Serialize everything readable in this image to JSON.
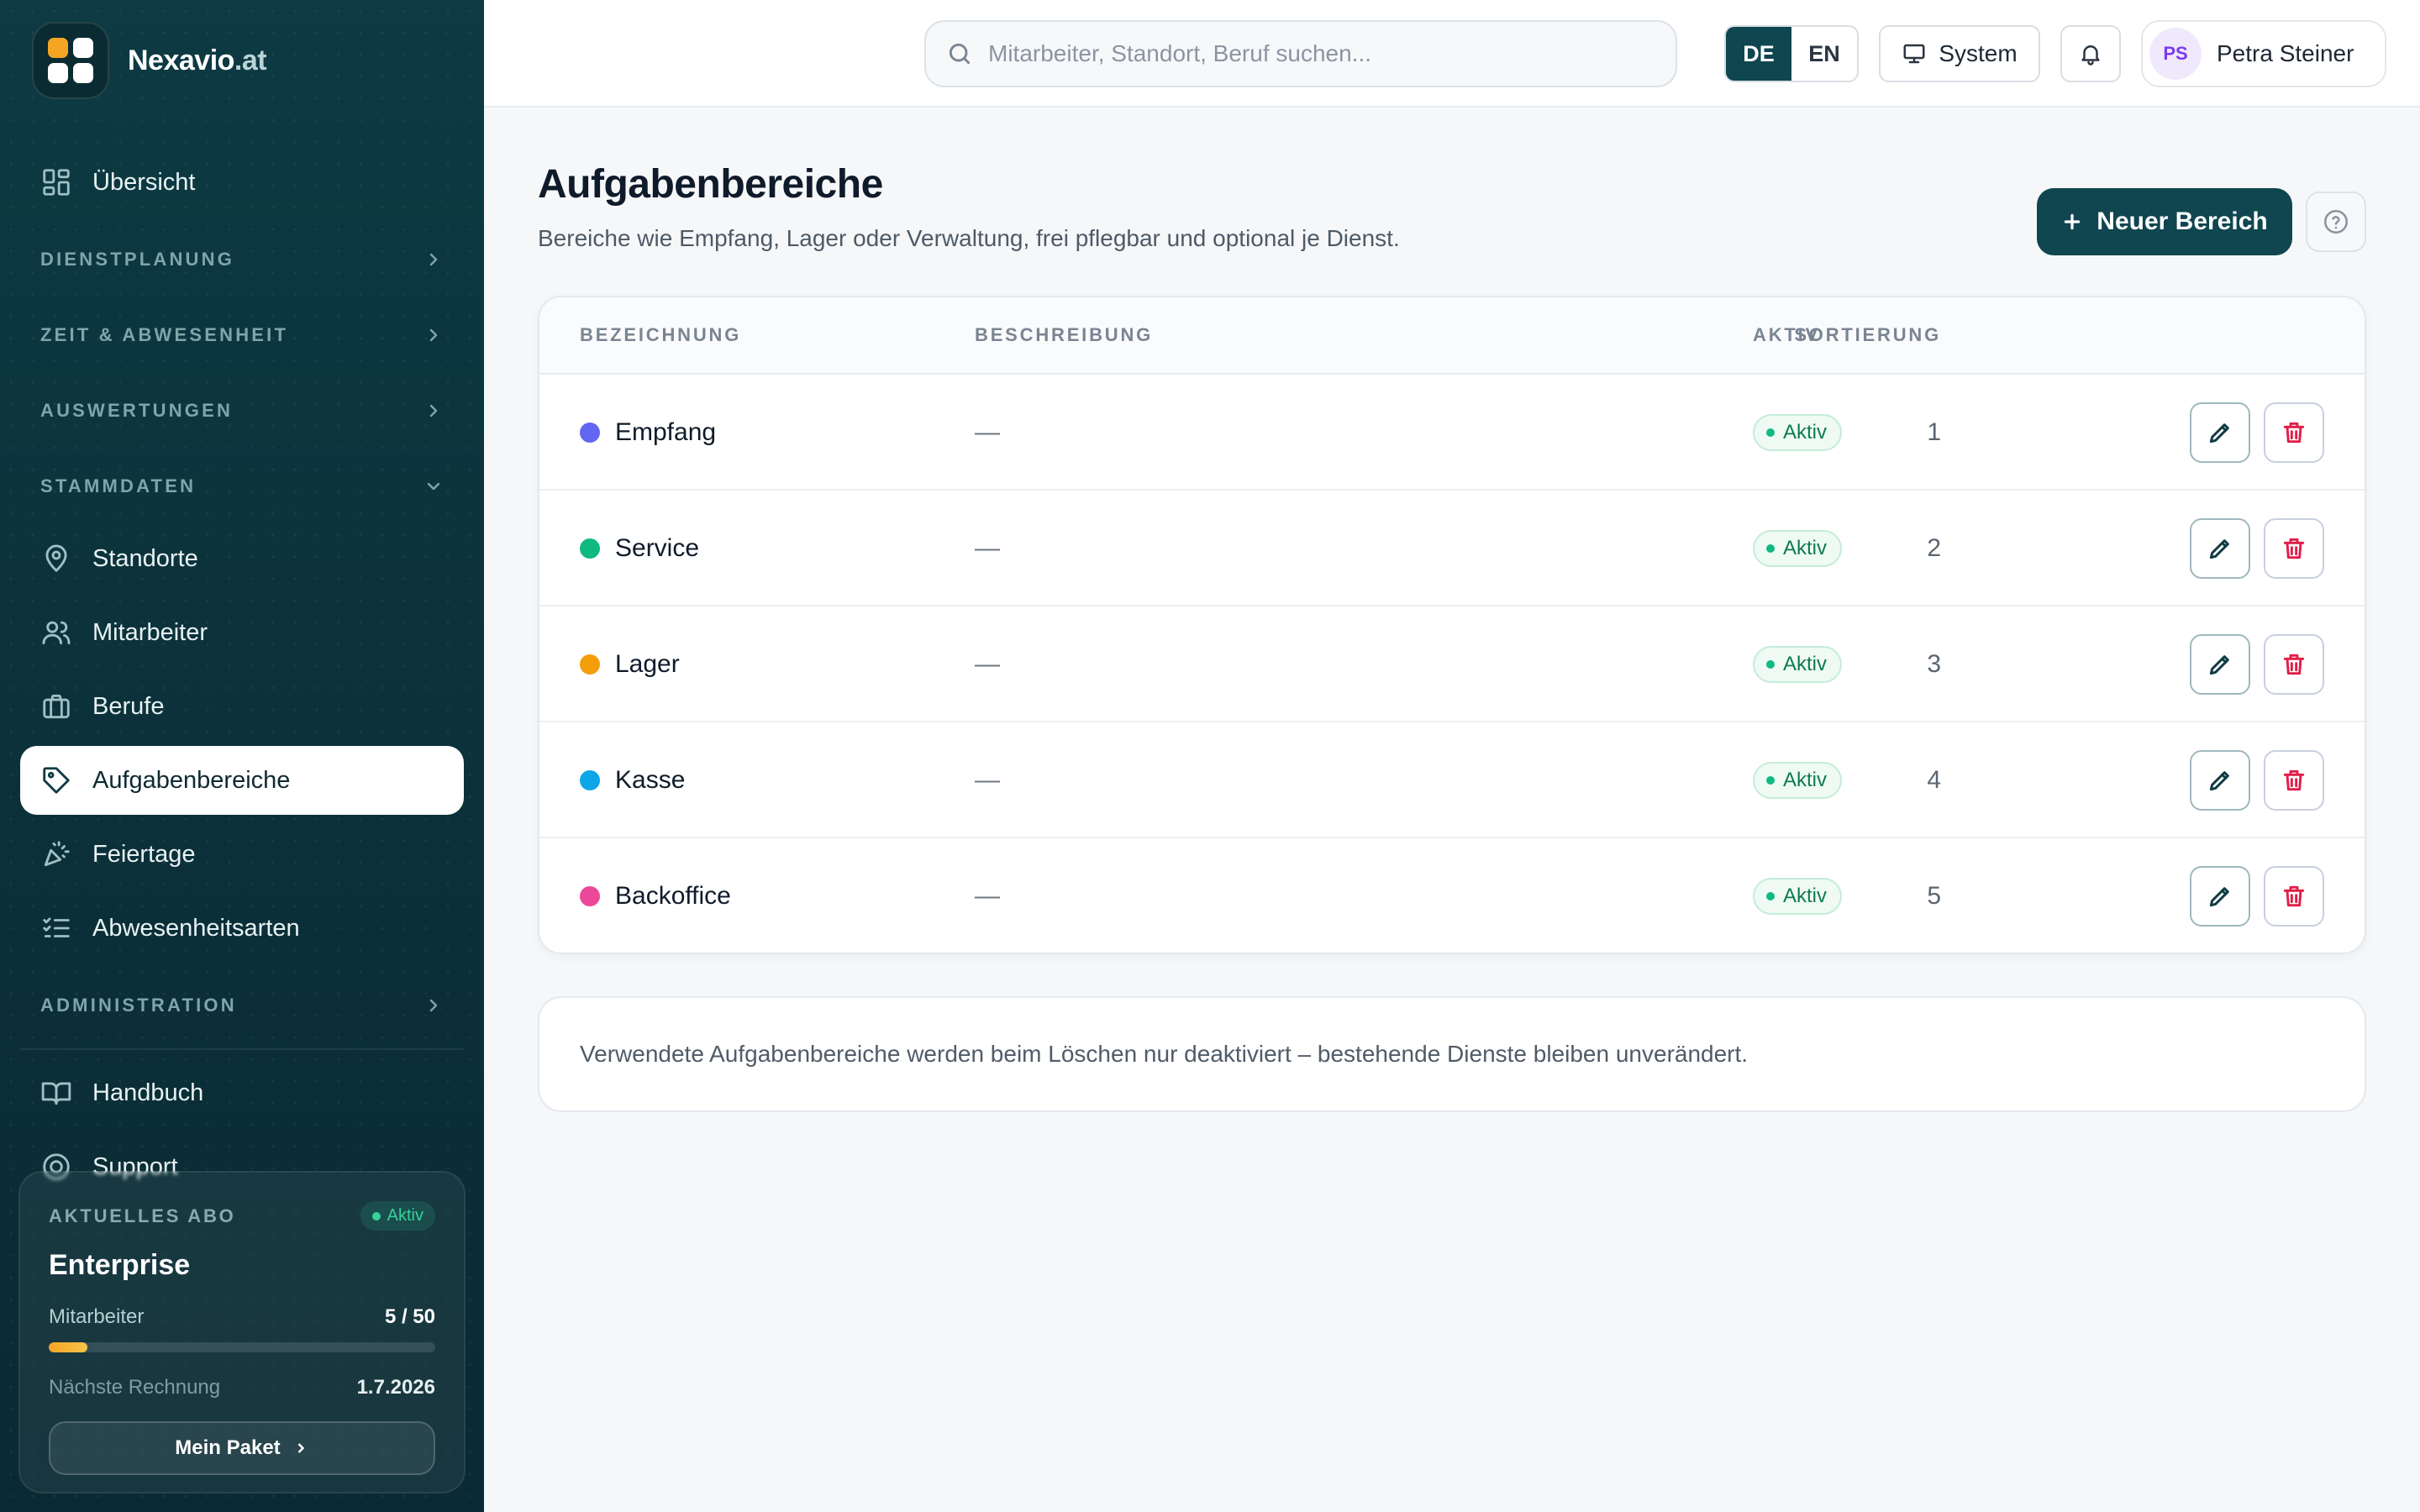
{
  "brand": {
    "name": "Nexavio",
    "tld": ".at"
  },
  "sidebar": {
    "overview": {
      "label": "Übersicht"
    },
    "sections": {
      "dienstplanung": "DIENSTPLANUNG",
      "zeit": "ZEIT & ABWESENHEIT",
      "auswertungen": "AUSWERTUNGEN",
      "stammdaten": "STAMMDATEN",
      "administration": "ADMINISTRATION"
    },
    "items": {
      "standorte": "Standorte",
      "mitarbeiter": "Mitarbeiter",
      "berufe": "Berufe",
      "aufgabenbereiche": "Aufgabenbereiche",
      "feiertage": "Feiertage",
      "abwesenheitsarten": "Abwesenheitsarten",
      "handbuch": "Handbuch",
      "support": "Support"
    },
    "plan": {
      "label": "AKTUELLES ABO",
      "status": "Aktiv",
      "name": "Enterprise",
      "employees_label": "Mitarbeiter",
      "employees_value": "5 / 50",
      "employees_fraction": 0.1,
      "next_invoice_label": "Nächste Rechnung",
      "next_invoice_value": "1.7.2026",
      "button": "Mein Paket"
    }
  },
  "topbar": {
    "search_placeholder": "Mitarbeiter, Standort, Beruf suchen...",
    "lang_de": "DE",
    "lang_en": "EN",
    "theme": "System",
    "user_initials": "PS",
    "user_name": "Petra Steiner"
  },
  "main": {
    "title": "Aufgabenbereiche",
    "subtitle": "Bereiche wie Empfang, Lager oder Verwaltung, frei pflegbar und optional je Dienst.",
    "new_button": "Neuer Bereich",
    "columns": {
      "name": "BEZEICHNUNG",
      "description": "BESCHREIBUNG",
      "sort": "SORTIERUNG",
      "active": "AKTIV"
    },
    "rows": [
      {
        "name": "Empfang",
        "color": "#6366f1",
        "description": "—",
        "sort": "1",
        "status": "Aktiv"
      },
      {
        "name": "Service",
        "color": "#10b981",
        "description": "—",
        "sort": "2",
        "status": "Aktiv"
      },
      {
        "name": "Lager",
        "color": "#f59e0b",
        "description": "—",
        "sort": "3",
        "status": "Aktiv"
      },
      {
        "name": "Kasse",
        "color": "#0ea5e9",
        "description": "—",
        "sort": "4",
        "status": "Aktiv"
      },
      {
        "name": "Backoffice",
        "color": "#ec4899",
        "description": "—",
        "sort": "5",
        "status": "Aktiv"
      }
    ],
    "note": "Verwendete Aufgabenbereiche werden beim Löschen nur deaktiviert – bestehende Dienste bleiben unverändert."
  },
  "colors": {
    "accent": "#0f4650",
    "sidebar_bg": "#0b3039",
    "active_green": "#10b981",
    "danger": "#e11d48"
  }
}
